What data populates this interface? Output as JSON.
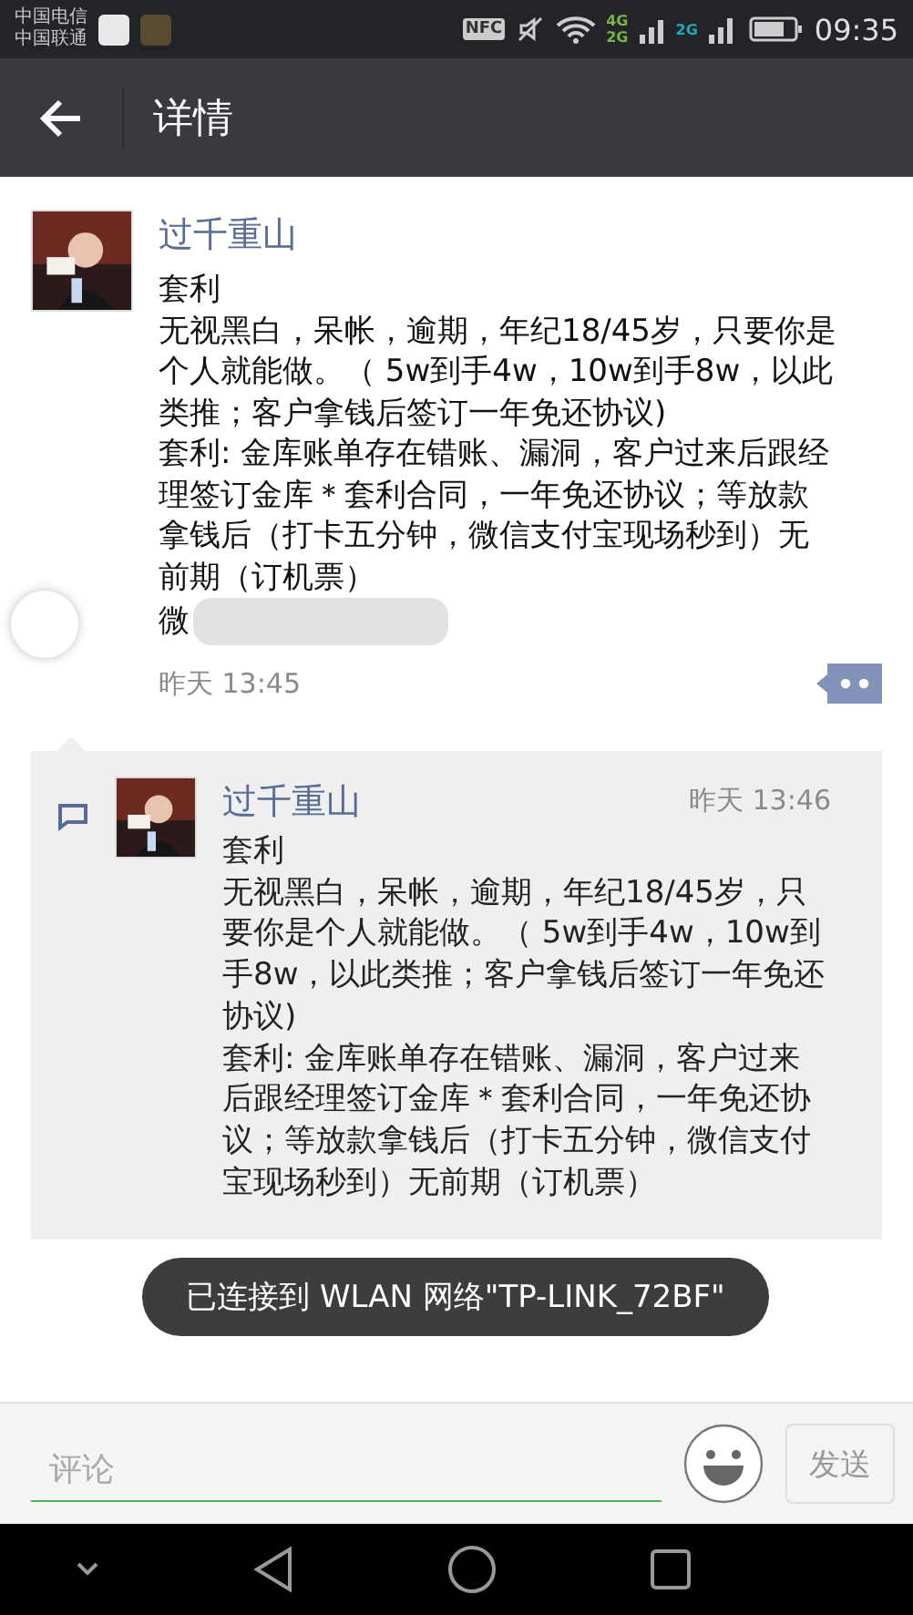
{
  "status_bar": {
    "carriers": [
      "中国电信",
      "中国联通"
    ],
    "nfc": "NFC",
    "sim1_labels": [
      "4G",
      "2G"
    ],
    "sim2_label": "2G",
    "time": "09:35"
  },
  "header": {
    "title": "详情"
  },
  "post": {
    "author": "过千重山",
    "paragraphs": [
      "套利",
      "无视黑白，呆帐，逾期，年纪18/45岁，只要你是个人就能做。（ 5w到手4w，10w到手8w，以此类推；客户拿钱后签订一年免还协议)",
      "套利: 金库账单存在错账、漏洞，客户过来后跟经理签订金库＊套利合同，一年免还协议；等放款拿钱后（打卡五分钟，微信支付宝现场秒到）无前期（订机票）"
    ],
    "partial_line": "微",
    "time": "昨天 13:45"
  },
  "comments": [
    {
      "author": "过千重山",
      "time": "昨天 13:46",
      "paragraphs": [
        "套利",
        "无视黑白，呆帐，逾期，年纪18/45岁，只要你是个人就能做。（ 5w到手4w，10w到手8w，以此类推；客户拿钱后签订一年免还协议)",
        "套利: 金库账单存在错账、漏洞，客户过来后跟经理签订金库＊套利合同，一年免还协议；等放款拿钱后（打卡五分钟，微信支付宝现场秒到）无前期（订机票）"
      ]
    }
  ],
  "toast": "已连接到 WLAN 网络\"TP-LINK_72BF\"",
  "input": {
    "placeholder": "评论",
    "send_label": "发送",
    "send_disabled": true
  }
}
